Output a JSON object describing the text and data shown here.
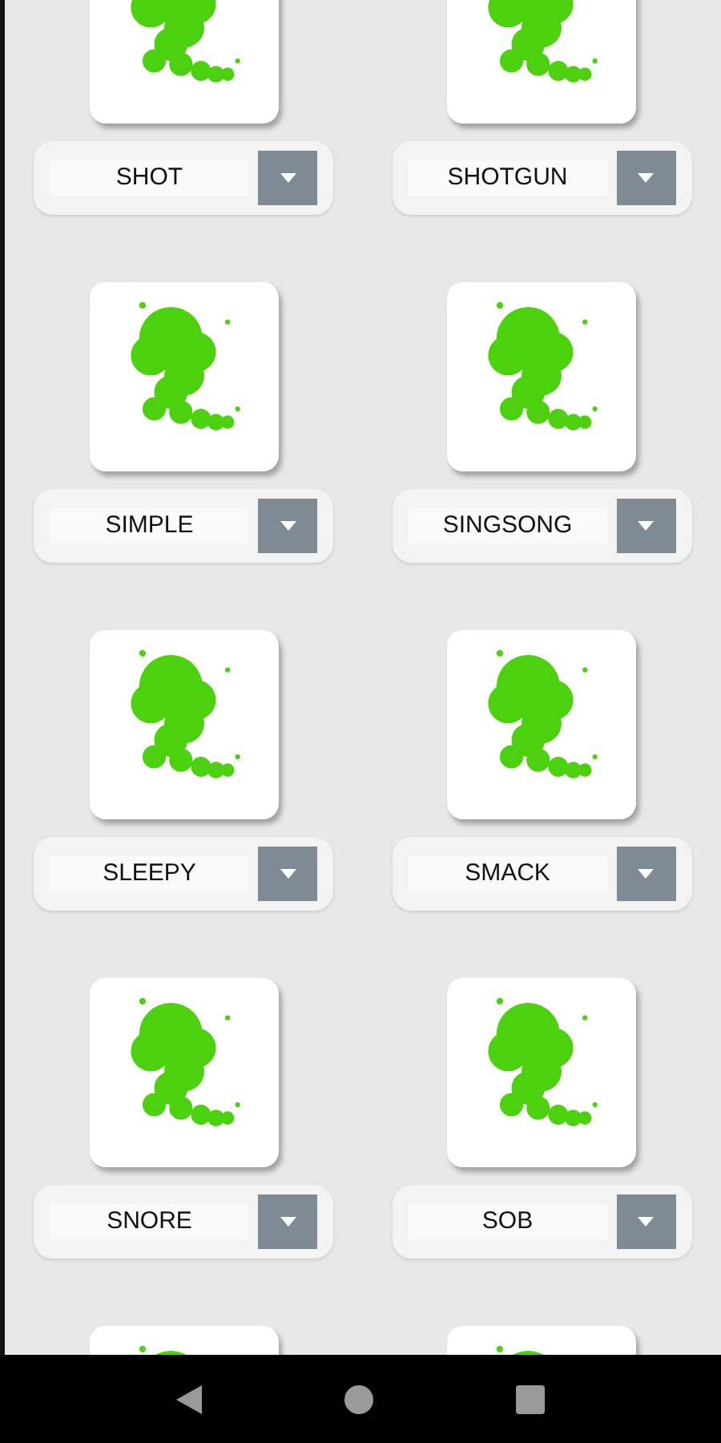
{
  "sounds": [
    {
      "kind": "full",
      "name": "SHOT"
    },
    {
      "kind": "full",
      "name": "SHOTGUN"
    },
    {
      "kind": "full",
      "name": "SIMPLE"
    },
    {
      "kind": "full",
      "name": "SINGSONG"
    },
    {
      "kind": "full",
      "name": "SLEEPY"
    },
    {
      "kind": "full",
      "name": "SMACK"
    },
    {
      "kind": "full",
      "name": "SNORE"
    },
    {
      "kind": "full",
      "name": "SOB"
    },
    {
      "kind": "cut"
    },
    {
      "kind": "cut"
    }
  ]
}
